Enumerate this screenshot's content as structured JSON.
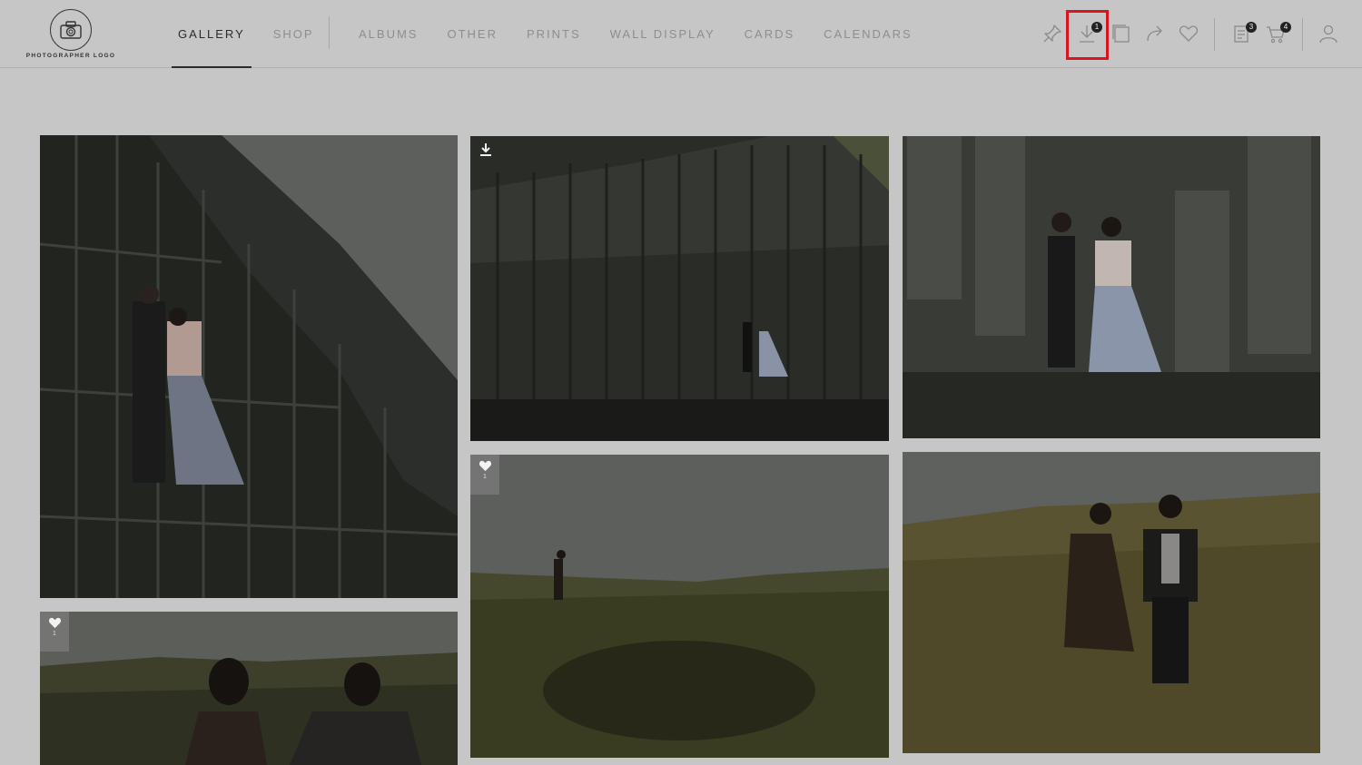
{
  "logo": {
    "text": "PHOTOGRAPHER LOGO"
  },
  "nav": {
    "primary": [
      {
        "label": "GALLERY",
        "active": true
      },
      {
        "label": "SHOP",
        "active": false
      }
    ],
    "secondary": [
      {
        "label": "ALBUMS"
      },
      {
        "label": "OTHER"
      },
      {
        "label": "PRINTS"
      },
      {
        "label": "WALL DISPLAY"
      },
      {
        "label": "CARDS"
      },
      {
        "label": "CALENDARS"
      }
    ]
  },
  "toolbar": {
    "icons": [
      "pin-icon",
      "download-icon",
      "slideshow-icon",
      "share-icon",
      "heart-icon",
      "orders-icon",
      "cart-icon",
      "account-icon"
    ],
    "download_badge": "1",
    "orders_badge": "3",
    "cart_badge": "4",
    "highlight_color": "#d8141c"
  },
  "gallery": {
    "photos": [
      {
        "name": "basalt-cliff-couple-tall",
        "overlay": ""
      },
      {
        "name": "basalt-wall-wide",
        "overlay": "download"
      },
      {
        "name": "basalt-couple-stepping",
        "overlay": ""
      },
      {
        "name": "couple-fjord-back",
        "overlay": "favorite",
        "favorite_count": "1"
      },
      {
        "name": "moss-field-walking",
        "overlay": "favorite",
        "favorite_count": "1"
      },
      {
        "name": "couple-holding-hands-field",
        "overlay": ""
      }
    ]
  }
}
